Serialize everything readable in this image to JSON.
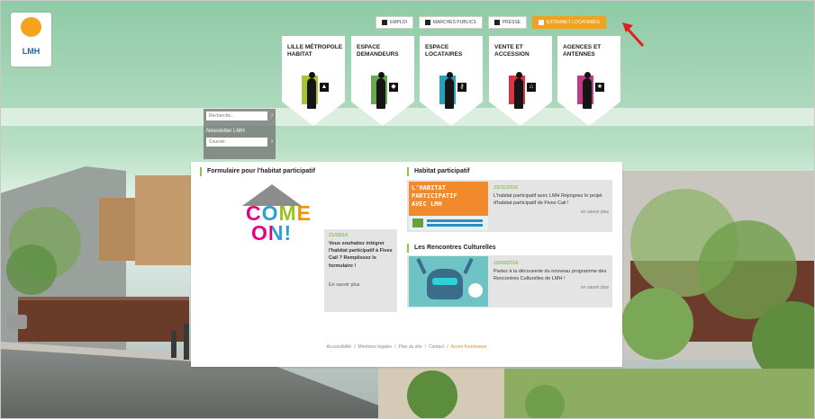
{
  "logo": {
    "text": "LMH"
  },
  "toplinks": [
    {
      "label": "EMPLOI",
      "highlight": false
    },
    {
      "label": "MARCHES PUBLICS",
      "highlight": false
    },
    {
      "label": "PRESSE",
      "highlight": false
    },
    {
      "label": "EXTRANET LOCATAIRES",
      "highlight": true
    }
  ],
  "nav": [
    {
      "label": "LILLE MÉTROPOLE HABITAT",
      "color": "#a8c43a",
      "icon": "building-icon"
    },
    {
      "label": "ESPACE DEMANDEURS",
      "color": "#6aa84f",
      "icon": "leaf-icon"
    },
    {
      "label": "ESPACE LOCATAIRES",
      "color": "#2a9fb5",
      "icon": "key-icon"
    },
    {
      "label": "VENTE ET ACCESSION",
      "color": "#d9343f",
      "icon": "house-icon"
    },
    {
      "label": "AGENCES ET ANTENNES",
      "color": "#c23a86",
      "icon": "star-icon"
    }
  ],
  "side": {
    "search_placeholder": "Recherche...",
    "newsletter_label": "Newsletter LMH",
    "email_placeholder": "Courriel",
    "go": "›"
  },
  "formulaire": {
    "title": "Formulaire pour l'habitat participatif",
    "come_line1": "COME",
    "come_line2": "ON!",
    "date": "21/06/16",
    "text": "Vous souhaitez intégrer l'habitat participatif à Fives Cail ? Remplissez le formulaire !",
    "more": "En savoir plus"
  },
  "habitat": {
    "title": "Habitat participatif",
    "thumb_text": "L'HABITAT PARTICIPATIF AVEC LMH",
    "date": "23/11/2016",
    "text": "L'habitat participatif avec LMH Rejoignez le projet d'habitat participatif de Fives Cail !",
    "more": "en savoir plus"
  },
  "rencontres": {
    "title": "Les Rencontres Culturelles",
    "date": "16/09/2016",
    "text": "Partez à la découverte du nouveau programme des Rencontres Culturelles de LMH !",
    "more": "en savoir plus"
  },
  "footer": {
    "links": [
      "Accessibilité",
      "Mentions légales",
      "Plan du site",
      "Contact"
    ],
    "accent_link": "Accès fournisseur",
    "separator": "/"
  }
}
